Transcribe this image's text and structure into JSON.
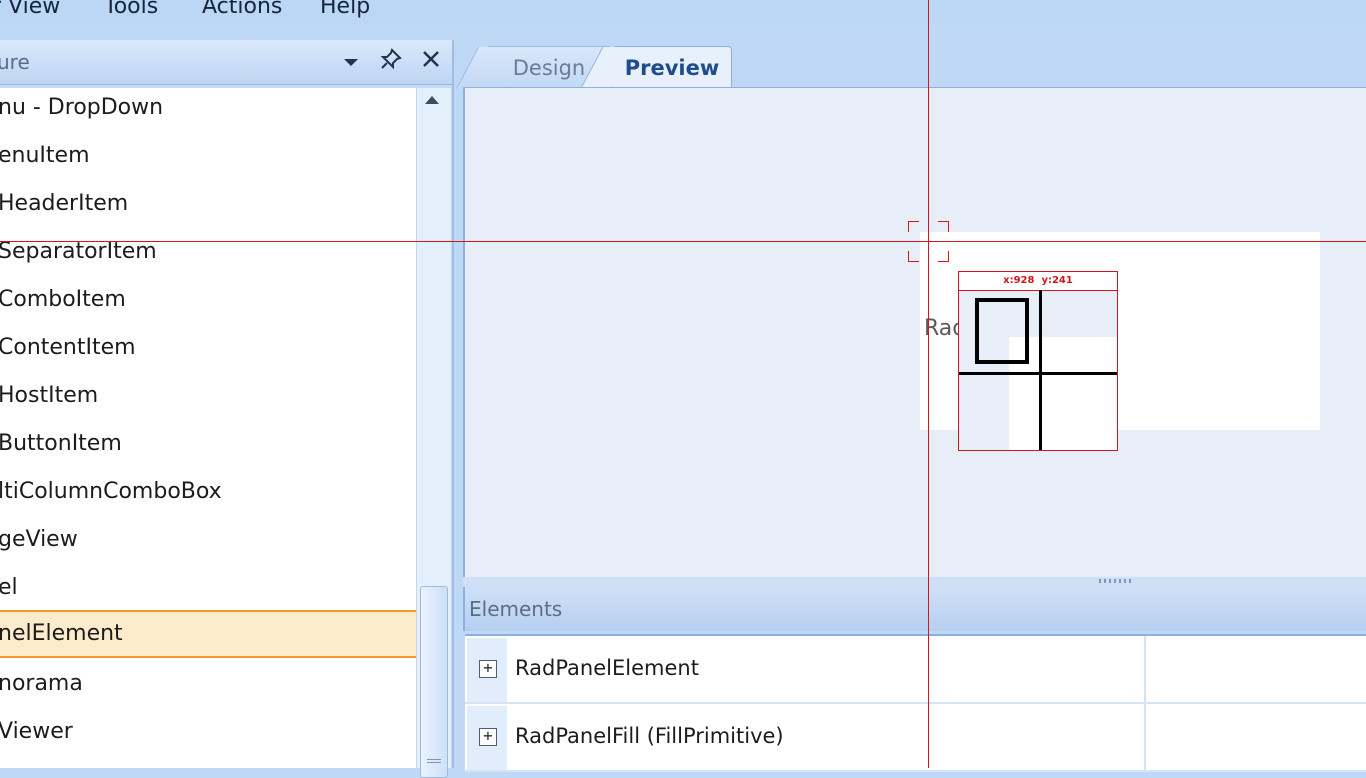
{
  "menu": {
    "items": [
      "View",
      "Tools",
      "Actions",
      "Help"
    ],
    "fragment": "r"
  },
  "left_panel": {
    "title": "ure",
    "items": [
      "nu - DropDown",
      "enuItem",
      "HeaderItem",
      "SeparatorItem",
      "ComboItem",
      "ContentItem",
      "HostItem",
      "ButtonItem",
      "ltiColumnComboBox",
      "geView",
      "el",
      "nelElement",
      "norama",
      "Viewer"
    ],
    "selected_index": 11,
    "icons": {
      "dropdown": "dropdown-arrow-icon",
      "pin": "pin-icon",
      "close": "close-icon"
    }
  },
  "tabs": [
    {
      "label": "Design",
      "active": false
    },
    {
      "label": "Preview",
      "active": true
    }
  ],
  "preview": {
    "partial_text": "Rad"
  },
  "magnifier": {
    "x_label": "x:928",
    "y_label": "y:241"
  },
  "elements": {
    "title": "Elements",
    "rows": [
      {
        "expander": "+",
        "label": "RadPanelElement"
      },
      {
        "expander": "+",
        "label": "RadPanelFill (FillPrimitive)"
      }
    ]
  },
  "colors": {
    "crosshair": "#d3161b",
    "selection_bg": "#fdeccb",
    "selection_border": "#f39a2c",
    "chrome": "#bfd8f6"
  }
}
